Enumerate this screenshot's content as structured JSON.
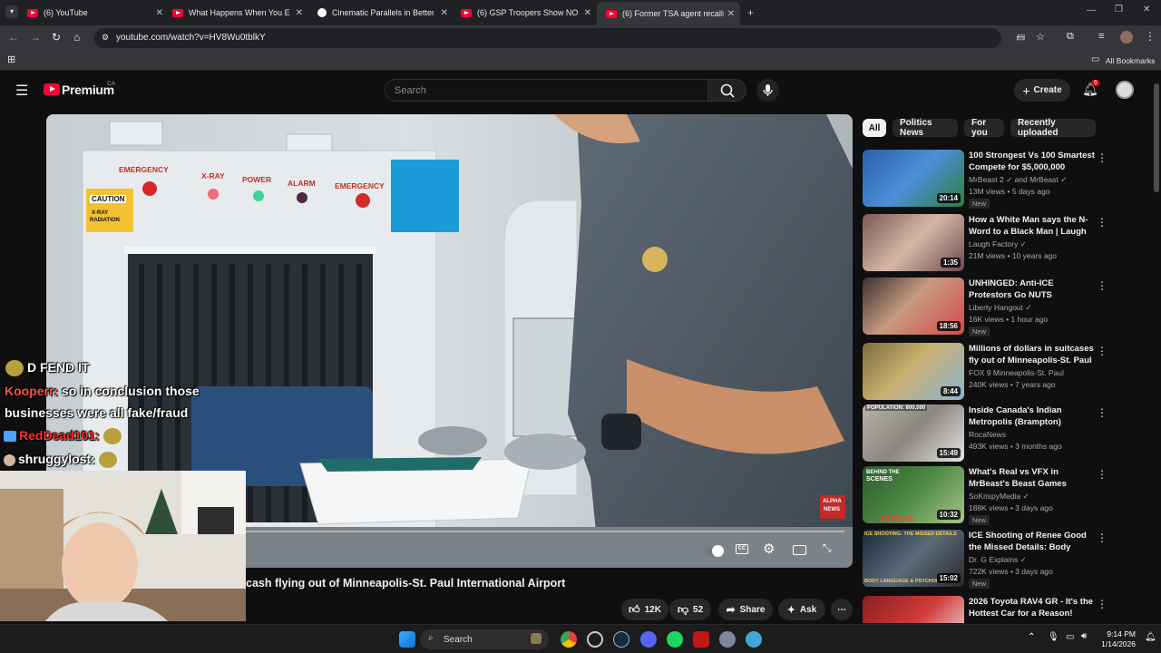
{
  "browser": {
    "tabs": [
      {
        "title": "(6) YouTube"
      },
      {
        "title": "What Happens When You Ente"
      },
      {
        "title": "Cinematic Parallels in Better Ca"
      },
      {
        "title": "(6) GSP Troopers Show NO MER"
      },
      {
        "title": "(6) Former TSA agent recalls m"
      }
    ],
    "url": "youtube.com/watch?v=HV8Wu0tblkY",
    "bookmarks_label": "All Bookmarks"
  },
  "youtube": {
    "logo_text": "Premium",
    "region": "CA",
    "search_placeholder": "Search",
    "create_label": "Create",
    "notification_count": "6"
  },
  "player": {
    "scene_labels": {
      "emergency_left": "EMERGENCY",
      "xray": "X-RAY",
      "power": "POWER",
      "alarm": "ALARM",
      "emergency_right": "EMERGENCY",
      "caution": "CAUTION",
      "caution_sub1": "X-RAY",
      "caution_sub2": "RADIATION",
      "watermark1": "ALPHA",
      "watermark2": "NEWS"
    }
  },
  "chat": [
    {
      "user": "",
      "text": "D FEND IT"
    },
    {
      "user": "Kooperr:",
      "text": "so in conclusion those"
    },
    {
      "user": "",
      "text": "businesses were all fake/fraud"
    },
    {
      "user": "RedDead101:",
      "text": ""
    },
    {
      "user": "shruggylost:",
      "text": ""
    }
  ],
  "video": {
    "title": "cash flying out of Minneapolis-St. Paul International Airport",
    "likes": "12K",
    "dislikes": "52",
    "share_label": "Share",
    "ask_label": "Ask"
  },
  "chips": [
    "All",
    "Politics News",
    "For you",
    "Recently uploaded"
  ],
  "recommendations": [
    {
      "title": "100 Strongest Vs 100 Smartest Compete for $5,000,000",
      "channel": "MrBeast 2 ✓ and MrBeast ✓",
      "meta": "13M views • 5 days ago",
      "badge": "New",
      "duration": "20:14"
    },
    {
      "title": "How a White Man says the N-Word to a Black Man | Laugh ...",
      "channel": "Laugh Factory ✓",
      "meta": "21M views • 10 years ago",
      "badge": "",
      "duration": "1:35"
    },
    {
      "title": "UNHINGED: Anti-ICE Protestors Go NUTS",
      "channel": "Liberty Hangout ✓",
      "meta": "16K views • 1 hour ago",
      "badge": "New",
      "duration": "18:56"
    },
    {
      "title": "Millions of dollars in suitcases fly out of Minneapolis-St. Paul ...",
      "channel": "FOX 9 Minneapolis-St. Paul",
      "meta": "240K views • 7 years ago",
      "badge": "",
      "duration": "8:44"
    },
    {
      "title": "Inside Canada's Indian Metropolis (Brampton)",
      "channel": "RocaNews",
      "meta": "493K views • 3 months ago",
      "badge": "",
      "duration": "15:49"
    },
    {
      "title": "What's Real vs VFX in MrBeast's Beast Games",
      "channel": "SoKrispyMedia ✓",
      "meta": "188K views • 3 days ago",
      "badge": "New",
      "duration": "10:32"
    },
    {
      "title": "ICE Shooting of Renee Good the Missed Details: Body Languag...",
      "channel": "Dr. G Explains ✓",
      "meta": "722K views • 3 days ago",
      "badge": "New",
      "duration": "15:02"
    },
    {
      "title": "2026 Toyota RAV4 GR - It's the Hottest Car for a Reason!",
      "channel": "",
      "meta": "",
      "badge": "",
      "duration": ""
    }
  ],
  "thumb_texts": {
    "t5": "POPULATION: 800,000",
    "t6a": "BEHIND THE",
    "t6b": "SCENES",
    "t6c": "$5,000,00",
    "t7a": "ICE SHOOTING: THE MISSED DETAILS",
    "t7b": "BODY LANGUAGE & PSYCHOLOG"
  },
  "taskbar": {
    "search_label": "Search",
    "time": "9:14 PM",
    "date": "1/14/2026"
  },
  "colors": {
    "yt_red": "#ff0033",
    "bg": "#0f0f0f",
    "chip": "#272727",
    "chat_user_1": "#ff4d4d",
    "chat_user_2": "#ff2d2d"
  }
}
